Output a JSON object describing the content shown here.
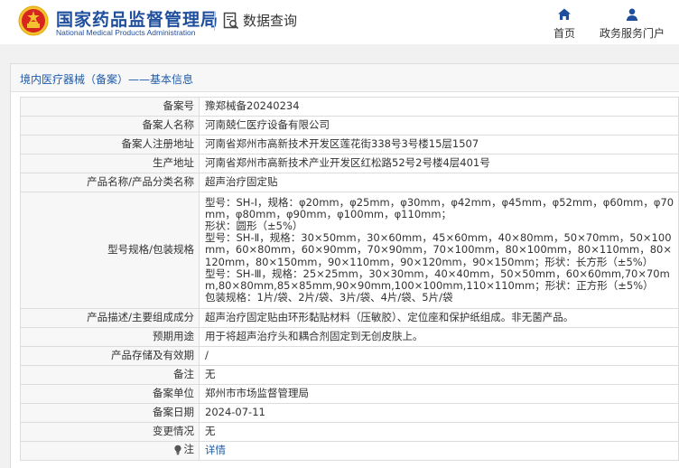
{
  "header": {
    "logo_cn": "国家药品监督管理局",
    "logo_en": "National Medical Products Administration",
    "search_title": "数据查询",
    "nav": [
      {
        "label": "首页",
        "icon": "home-icon"
      },
      {
        "label": "政务服务门户",
        "icon": "user-icon"
      }
    ]
  },
  "panel": {
    "title": "境内医疗器械（备案）——基本信息"
  },
  "record": {
    "rows": [
      {
        "key": "备案号",
        "value": "豫郑械备20240234"
      },
      {
        "key": "备案人名称",
        "value": "河南兢仁医疗设备有限公司"
      },
      {
        "key": "备案人注册地址",
        "value": "河南省郑州市高新技术开发区莲花街338号3号楼15层1507"
      },
      {
        "key": "生产地址",
        "value": "河南省郑州市高新技术产业开发区红松路52号2号楼4层401号"
      },
      {
        "key": "产品名称/产品分类名称",
        "value": "超声治疗固定贴"
      },
      {
        "key": "型号规格/包装规格",
        "lines": [
          "型号：SH-Ⅰ，规格：φ20mm，φ25mm，φ30mm，φ42mm，φ45mm，φ52mm，φ60mm，φ70mm，φ80mm，φ90mm，φ100mm，φ110mm；",
          "形状：圆形（±5%）",
          "型号：SH-Ⅱ，规格：30×50mm，30×60mm，45×60mm，40×80mm，50×70mm，50×100mm，60×80mm，60×90mm，70×90mm，70×100mm，80×100mm，80×110mm，80×120mm，80×150mm，90×110mm，90×120mm，90×150mm；形状：长方形（±5%）",
          "型号：SH-Ⅲ，规格：25×25mm，30×30mm，40×40mm，50×50mm，60×60mm,70×70mm,80×80mm,85×85mm,90×90mm,100×100mm,110×110mm；形状：正方形（±5%）",
          "包装规格：1片/袋、2片/袋、3片/袋、4片/袋、5片/袋"
        ]
      },
      {
        "key": "产品描述/主要组成成分",
        "value": "超声治疗固定贴由环形黏贴材料（压敏胶）、定位座和保护纸组成。非无菌产品。"
      },
      {
        "key": "预期用途",
        "value": "用于将超声治疗头和耦合剂固定到无创皮肤上。"
      },
      {
        "key": "产品存储及有效期",
        "value": "/"
      },
      {
        "key": "备注",
        "value": "无"
      },
      {
        "key": "备案单位",
        "value": "郑州市市场监督管理局"
      },
      {
        "key": "备案日期",
        "value": "2024-07-11"
      },
      {
        "key": "变更情况",
        "value": "无"
      },
      {
        "key": "注",
        "value": "详情"
      }
    ]
  },
  "colors": {
    "brand_blue": "#1f4e9c",
    "link_blue": "#1f5ba8",
    "emblem_red": "#d7261d",
    "emblem_gold": "#f2c230"
  }
}
